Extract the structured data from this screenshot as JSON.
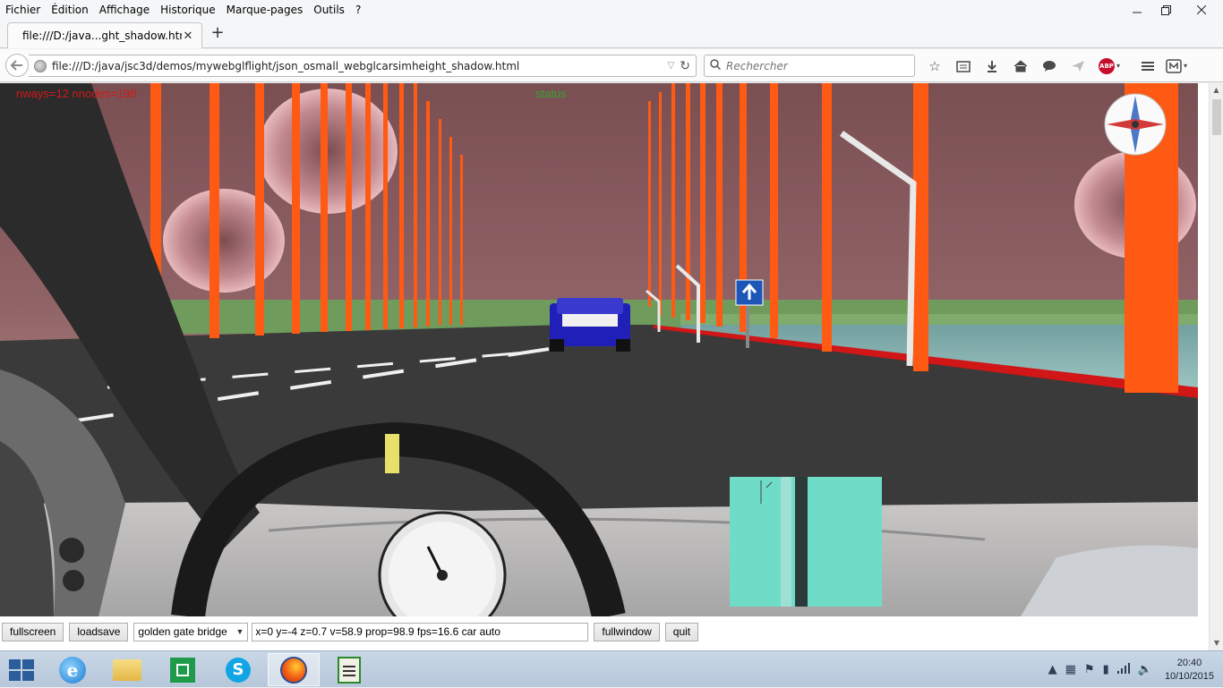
{
  "menu": {
    "items": [
      "Fichier",
      "Édition",
      "Affichage",
      "Historique",
      "Marque-pages",
      "Outils",
      "?"
    ]
  },
  "window_controls": {
    "minimize_icon": "minimize-icon",
    "restore_icon": "restore-icon",
    "close_icon": "close-icon"
  },
  "tab": {
    "title": "file:///D:/java...ght_shadow.html",
    "close_glyph": "✕",
    "new_tab_glyph": "+"
  },
  "nav": {
    "url": "file:///D:/java/jsc3d/demos/mywebglflight/json_osmall_webglcarsimheight_shadow.html",
    "search_placeholder": "Rechercher"
  },
  "toolbar_icons": [
    "star-icon",
    "reading-list-icon",
    "download-icon",
    "home-icon",
    "chat-icon",
    "send-icon",
    "adblock-icon",
    "menu-icon",
    "extension-icon"
  ],
  "scene": {
    "stats": "nways=12 nnodes=198",
    "status": "status",
    "colors": {
      "sky": "#8f6266",
      "towers": "#ff5a14",
      "road": "#3b3b3b",
      "car": "#2020b8",
      "minimap": "#6fdcc8"
    }
  },
  "controls": {
    "fullscreen": "fullscreen",
    "loadsave": "loadsave",
    "scene_select": "golden gate bridge",
    "telemetry": "x=0  y=-4  z=0.7  v=58.9  prop=98.9 fps=16.6 car auto",
    "fullwindow": "fullwindow",
    "quit": "quit"
  },
  "taskbar": {
    "apps": [
      "internet-explorer-icon",
      "file-explorer-icon",
      "store-icon",
      "skype-icon",
      "firefox-icon",
      "editor-icon"
    ],
    "time": "20:40",
    "date": "10/10/2015"
  }
}
